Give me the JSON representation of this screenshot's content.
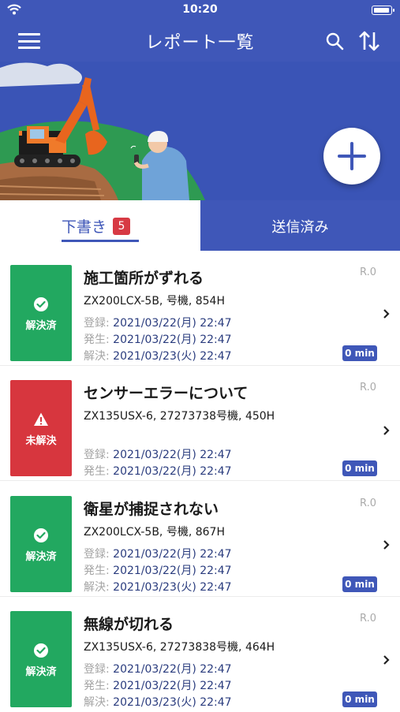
{
  "status_bar": {
    "time": "10:20",
    "wifi_icon": "wifi-icon",
    "battery_icon": "battery-icon"
  },
  "nav": {
    "title": "レポート一覧",
    "menu_icon": "hamburger-menu-icon",
    "search_icon": "search-icon",
    "sort_icon": "sort-icon"
  },
  "banner": {
    "illustration": "excavator-and-worker-illustration",
    "add_icon": "plus-icon"
  },
  "tabs": {
    "draft": {
      "label": "下書き",
      "badge": "5"
    },
    "sent": {
      "label": "送信済み"
    }
  },
  "labels": {
    "registered": "登録: ",
    "occurred": "発生: ",
    "resolved_at": "解決: "
  },
  "reports": [
    {
      "title": "施工箇所がずれる",
      "machine": "ZX200LCX-5B, 号機, 854H",
      "status": "解決済",
      "revision": "R.0",
      "registered": "2021/03/22(月) 22:47",
      "occurred": "2021/03/22(月) 22:47",
      "resolved_at": "2021/03/23(火) 22:47",
      "duration": "0 min"
    },
    {
      "title": "センサーエラーについて",
      "machine": "ZX135USX-6, 27273738号機, 450H",
      "status": "未解決",
      "revision": "R.0",
      "registered": "2021/03/22(月) 22:47",
      "occurred": "2021/03/22(月) 22:47",
      "duration": "0 min"
    },
    {
      "title": "衛星が捕捉されない",
      "machine": "ZX200LCX-5B, 号機, 867H",
      "status": "解決済",
      "revision": "R.0",
      "registered": "2021/03/22(月) 22:47",
      "occurred": "2021/03/22(月) 22:47",
      "resolved_at": "2021/03/23(火) 22:47",
      "duration": "0 min"
    },
    {
      "title": "無線が切れる",
      "machine": "ZX135USX-6, 27273838号機, 464H",
      "status": "解決済",
      "revision": "R.0",
      "registered": "2021/03/22(月) 22:47",
      "occurred": "2021/03/22(月) 22:47",
      "resolved_at": "2021/03/23(火) 22:47",
      "duration": "0 min"
    }
  ],
  "colors": {
    "primary": "#3f57b8",
    "resolved": "#22a860",
    "unresolved": "#d7363e",
    "badge": "#d73a44"
  }
}
